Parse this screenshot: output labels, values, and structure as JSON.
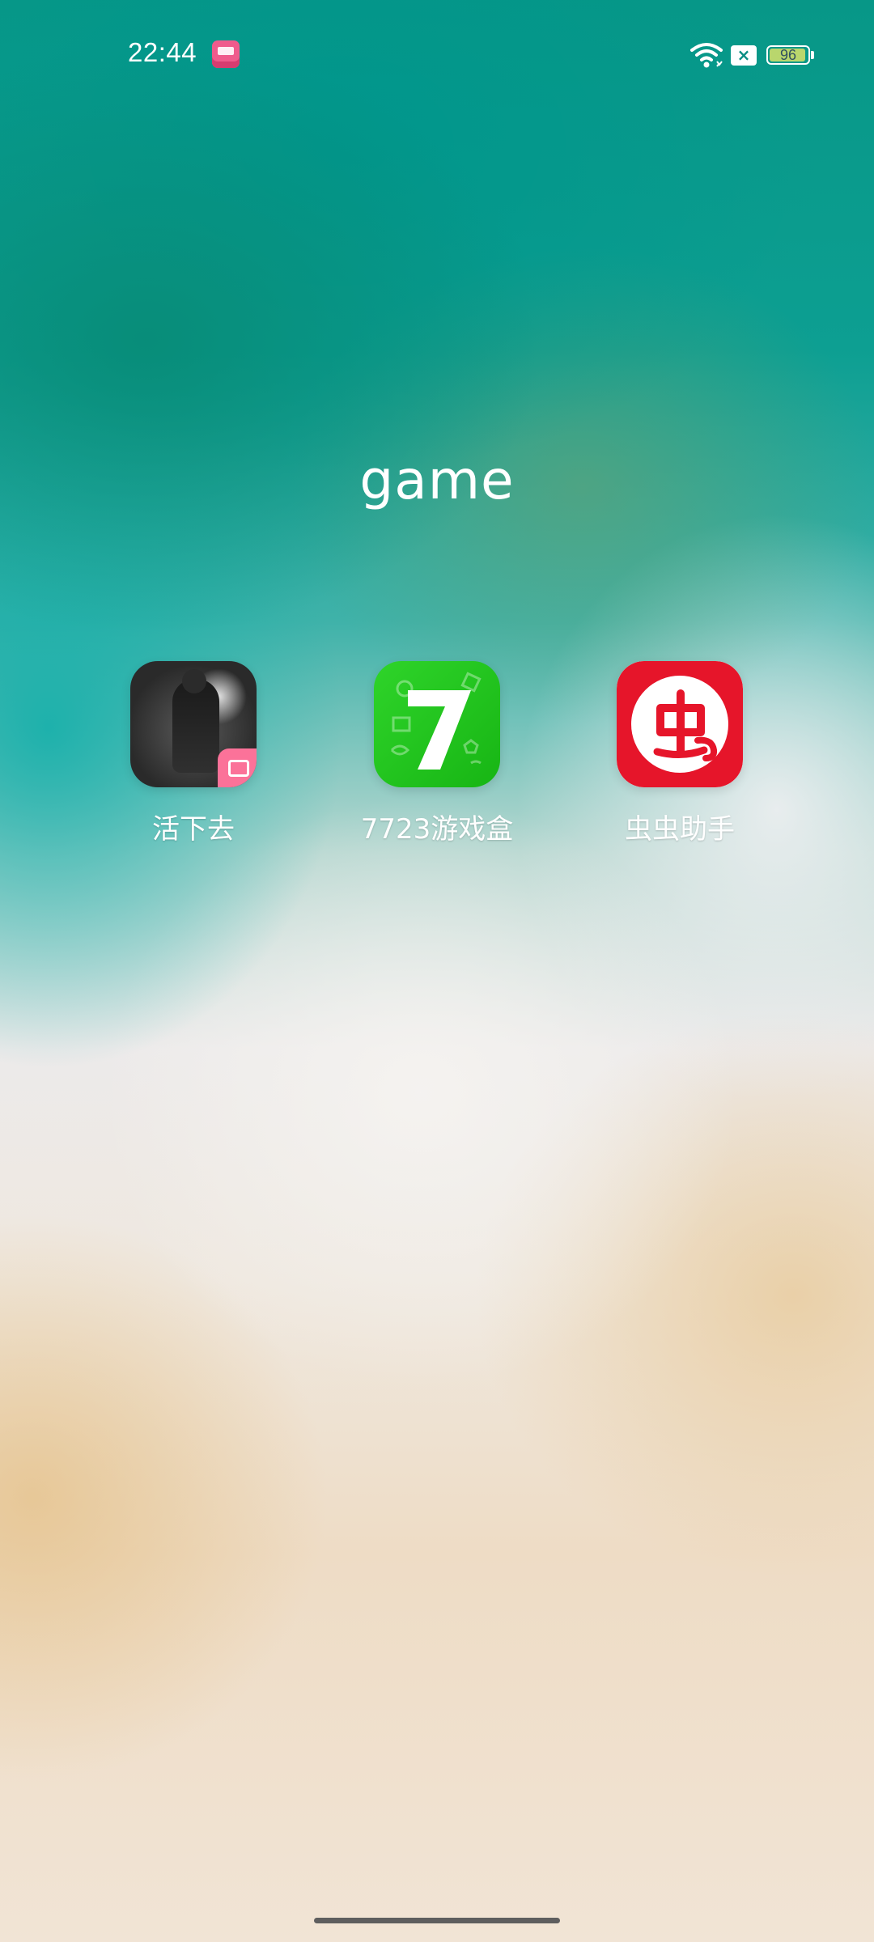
{
  "status_bar": {
    "time": "22:44",
    "notification_icon": "bilibili-notification-icon",
    "wifi_icon": "wifi-icon",
    "sim_icon": "no-sim-icon",
    "sim_symbol": "×",
    "battery_level": "96",
    "battery_fraction": 0.96
  },
  "folder": {
    "title": "game",
    "apps": [
      {
        "label": "活下去",
        "icon": "survival-game-icon"
      },
      {
        "label": "7723游戏盒",
        "icon": "7723-game-box-icon"
      },
      {
        "label": "虫虫助手",
        "icon": "chongchong-helper-icon"
      }
    ]
  },
  "colors": {
    "bili_pink": "#fb7299",
    "green": "#17b514",
    "red": "#e6152a",
    "battery_green": "#b9d66d"
  }
}
